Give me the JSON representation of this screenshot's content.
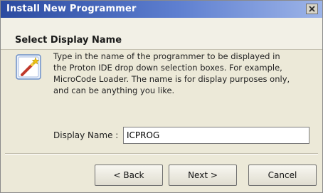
{
  "window": {
    "title": "Install New Programmer",
    "close_icon": "close-icon"
  },
  "header": {
    "title": "Select Display Name",
    "icon": "wizard-wand-icon"
  },
  "description": {
    "lines": [
      "Type in the name of the programmer to be displayed in",
      "the Proton IDE drop down selection boxes.  For example,",
      "MicroCode Loader. The name is for display purposes only,",
      "and can be anything you like."
    ]
  },
  "form": {
    "display_name_label": "Display Name :",
    "display_name_value": "ICPROG"
  },
  "buttons": {
    "back": "< Back",
    "next": "Next >",
    "cancel": "Cancel"
  }
}
